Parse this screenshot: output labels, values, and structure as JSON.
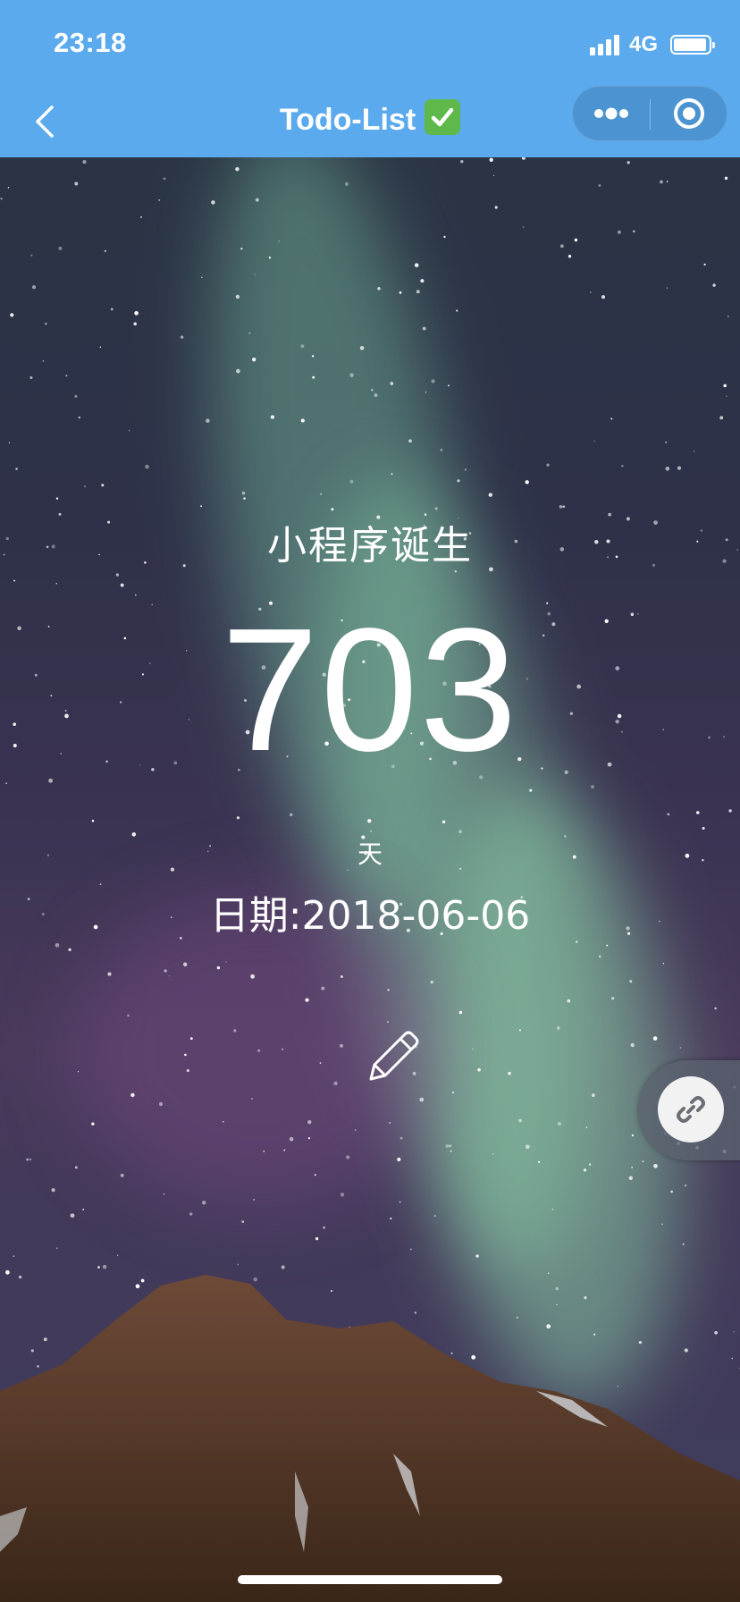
{
  "status_bar": {
    "time": "23:18",
    "network": "4G"
  },
  "nav": {
    "title": "Todo-List",
    "title_emoji_icon": "check-mark-button-icon",
    "back_icon": "chevron-left-icon",
    "menu_icon": "more-dots-icon",
    "close_icon": "target-circle-icon"
  },
  "countdown": {
    "event_name": "小程序诞生",
    "days": "703",
    "unit": "天",
    "date": "日期:2018-06-06",
    "edit_icon": "pencil-icon"
  },
  "share_handle": {
    "icon": "link-icon"
  },
  "colors": {
    "header_blue": "#5aaaed",
    "text": "#ffffff",
    "check_green": "#5fb94a"
  }
}
